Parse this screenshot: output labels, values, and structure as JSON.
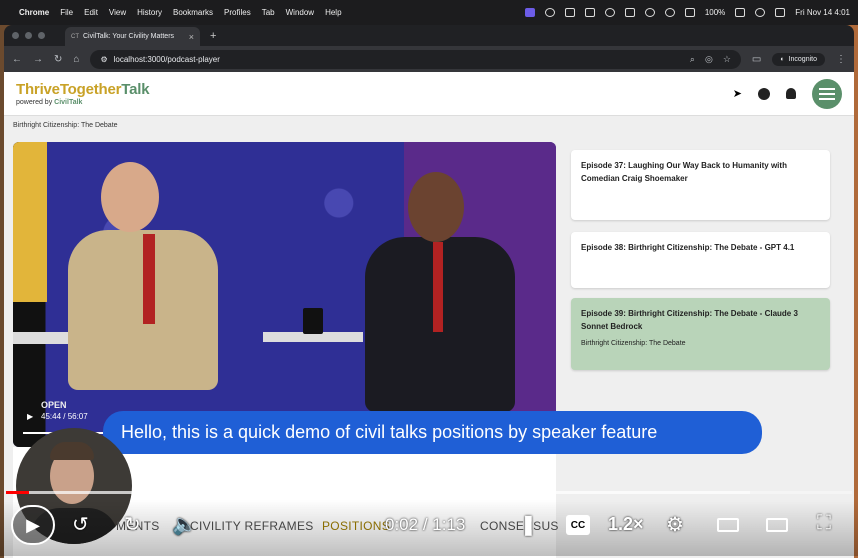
{
  "menubar": {
    "app": "Chrome",
    "items": [
      "File",
      "Edit",
      "View",
      "History",
      "Bookmarks",
      "Profiles",
      "Tab",
      "Window",
      "Help"
    ],
    "battery": "100%",
    "datetime": "Fri Nov 14  4:01"
  },
  "browser": {
    "tab_favicon": "CT",
    "tab_title": "CivilTalk: Your Civility Matters",
    "url": "localhost:3000/podcast-player",
    "incognito_label": "Incognito"
  },
  "site": {
    "logo_part1": "ThriveTogether",
    "logo_part2": "Talk",
    "powered_by": "powered by",
    "powered_brand": "CivilTalk",
    "breadcrumb": "Birthright Citizenship: The Debate"
  },
  "video": {
    "time": "45:44 / 56:07",
    "logo": "OPEN",
    "progress": 0.8
  },
  "episodes": [
    {
      "title": "Episode 37: Laughing Our Way Back to Humanity with Comedian Craig Shoemaker",
      "subtitle": ""
    },
    {
      "title": "Episode 38: Birthright Citizenship: The Debate - GPT 4.1",
      "subtitle": ""
    },
    {
      "title": "Episode 39: Birthright Citizenship: The Debate - Claude 3 Sonnet Bedrock",
      "subtitle": "Birthright Citizenship: The Debate"
    }
  ],
  "caption": "Hello, this is a quick demo of civil talks positions by speaker feature",
  "page_tabs": {
    "moments": "MENTS",
    "civility": "CIVILITY REFRAMES",
    "positions": "POSITIONS",
    "consensus": "CONSENSUS"
  },
  "player": {
    "current_time": "0:02",
    "separator": " / ",
    "duration": "1:13",
    "speed": "1.2×",
    "cc": "CC",
    "progress": 0.027,
    "buffered": 0.88
  }
}
